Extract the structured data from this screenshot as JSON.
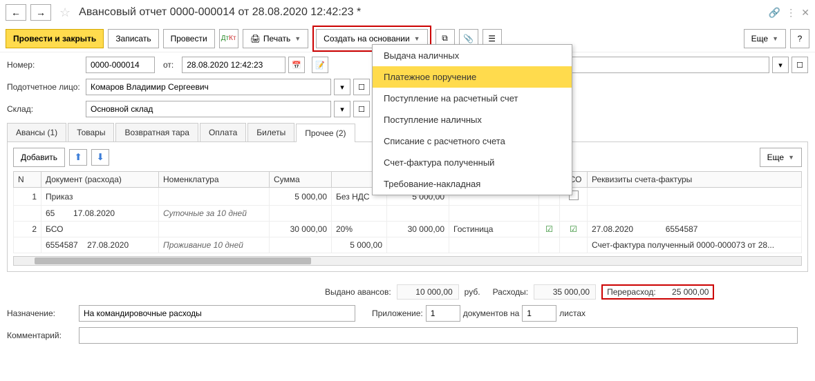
{
  "title": "Авансовый отчет 0000-000014 от 28.08.2020 12:42:23 *",
  "toolbar": {
    "save_close": "Провести и закрыть",
    "save": "Записать",
    "post": "Провести",
    "print": "Печать",
    "create_based": "Создать на основании",
    "more": "Еще",
    "help": "?"
  },
  "dropdown": {
    "items": [
      "Выдача наличных",
      "Платежное поручение",
      "Поступление на расчетный счет",
      "Поступление наличных",
      "Списание с расчетного счета",
      "Счет-фактура полученный",
      "Требование-накладная"
    ],
    "highlighted_index": 1
  },
  "form": {
    "number_label": "Номер:",
    "number": "0000-000014",
    "date_label": "от:",
    "date": "28.08.2020 12:42:23",
    "person_label": "Подотчетное лицо:",
    "person": "Комаров Владимир Сергеевич",
    "warehouse_label": "Склад:",
    "warehouse": "Основной склад"
  },
  "tabs": [
    "Авансы (1)",
    "Товары",
    "Возвратная тара",
    "Оплата",
    "Билеты",
    "Прочее (2)"
  ],
  "active_tab": 5,
  "table": {
    "add_btn": "Добавить",
    "more_btn": "Еще",
    "headers": [
      "N",
      "Документ (расхода)",
      "Номенклатура",
      "Сумма",
      "",
      "",
      "",
      "",
      "БСО",
      "Реквизиты счета-фактуры"
    ],
    "rows": [
      {
        "n": "1",
        "doc": "Приказ",
        "nom": "",
        "sum": "5 000,00",
        "vat": "Без НДС",
        "total": "5 000,00",
        "name": "",
        "check1": "",
        "bso": "empty",
        "req": ""
      },
      {
        "n": "",
        "doc": "65",
        "doc_date": "17.08.2020",
        "nom_italic": "Суточные за 10 дней",
        "sum": "",
        "vat": "",
        "total": "",
        "name": "",
        "check1": "",
        "bso": "",
        "req": ""
      },
      {
        "n": "2",
        "doc": "БСО",
        "nom": "",
        "sum": "30 000,00",
        "vat": "20%",
        "total": "30 000,00",
        "name": "Гостиница",
        "check1": "yes",
        "bso": "yes",
        "req_date": "27.08.2020",
        "req_num": "6554587"
      },
      {
        "n": "",
        "doc": "6554587",
        "doc_date": "27.08.2020",
        "nom_italic": "Проживание 10 дней",
        "sum": "",
        "vat": "5 000,00",
        "total": "",
        "name": "",
        "check1": "",
        "bso": "",
        "req": "Счет-фактура полученный 0000-000073 от 28..."
      }
    ]
  },
  "summary": {
    "advances_label": "Выдано авансов:",
    "advances": "10 000,00",
    "currency": "руб.",
    "expenses_label": "Расходы:",
    "expenses": "35 000,00",
    "over_label": "Перерасход:",
    "over": "25 000,00"
  },
  "footer": {
    "purpose_label": "Назначение:",
    "purpose": "На командировочные расходы",
    "attach_label": "Приложение:",
    "attach_count": "1",
    "docs_on": "документов на",
    "sheets_count": "1",
    "sheets": "листах",
    "comment_label": "Комментарий:"
  }
}
